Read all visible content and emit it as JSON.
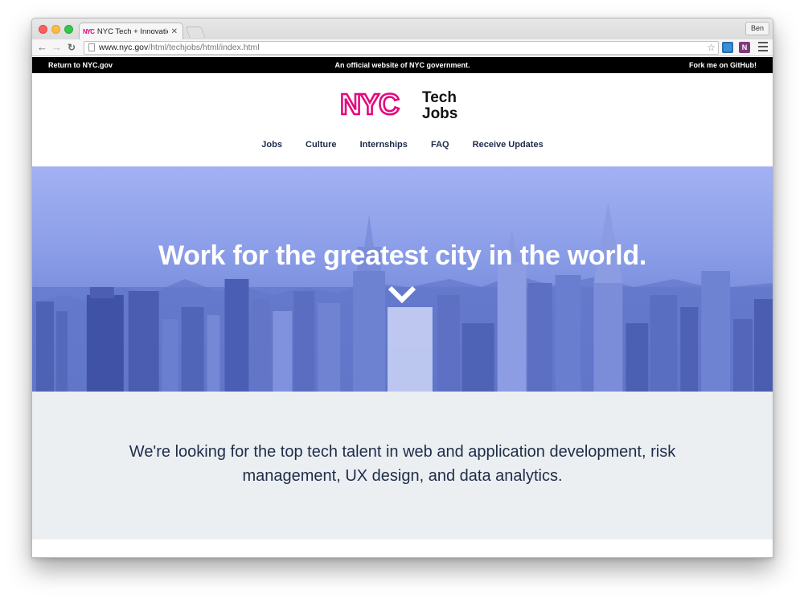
{
  "browser": {
    "tab_favicon": "NYC",
    "tab_title": "NYC Tech + Innovation Jobs",
    "tab_close": "✕",
    "profile_name": "Ben",
    "url_host": "www.nyc.gov",
    "url_path": "/html/techjobs/html/index.html",
    "extension_onenote": "N",
    "icons": [
      "back-arrow-icon",
      "forward-arrow-icon",
      "reload-icon",
      "page-icon",
      "star-icon",
      "extension-icon",
      "onenote-icon",
      "menu-icon"
    ]
  },
  "govbar": {
    "left": "Return to NYC.gov",
    "center": "An official website of NYC government.",
    "right": "Fork me on GitHub!"
  },
  "logo": {
    "mark": "NYC",
    "line1": "Tech",
    "line2": "Jobs",
    "accent": "#e4087d"
  },
  "nav": {
    "items": [
      "Jobs",
      "Culture",
      "Internships",
      "FAQ",
      "Receive Updates"
    ]
  },
  "hero": {
    "title": "Work for the greatest city in the world.",
    "overlay_color": "#8097e6"
  },
  "intro": {
    "text": "We're looking for the top tech talent in web and application development, risk management, UX design, and data analytics."
  }
}
